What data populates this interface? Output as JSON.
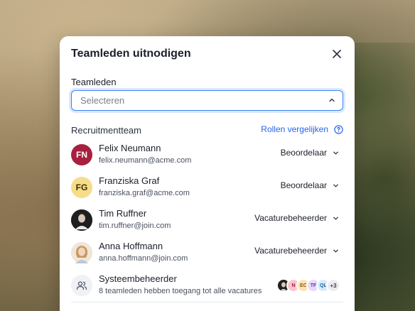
{
  "dialog": {
    "title": "Teamleden uitnodigen",
    "close_icon": "close-icon"
  },
  "team_field": {
    "label": "Teamleden",
    "placeholder": "Selecteren",
    "accent": "#3b82f6"
  },
  "section": {
    "title": "Recruitmentteam",
    "roles_link": "Rollen vergelijken",
    "help_icon": "help-circle-icon",
    "link_color": "#2563eb"
  },
  "members": [
    {
      "initials": "FN",
      "name": "Felix Neumann",
      "email": "felix.neumann@acme.com",
      "role": "Beoordelaar",
      "avatar_bg": "#a8203f",
      "avatar_fg": "#ffffff"
    },
    {
      "initials": "FG",
      "name": "Franziska Graf",
      "email": "franziska.graf@acme.com",
      "role": "Beoordelaar",
      "avatar_bg": "#f6dd8a",
      "avatar_fg": "#3b3000"
    },
    {
      "initials": "",
      "name": "Tim Ruffner",
      "email": "tim.ruffner@join.com",
      "role": "Vacaturebeheerder",
      "avatar_bg": "#1f1f1f",
      "avatar_fg": "#ffffff"
    },
    {
      "initials": "",
      "name": "Anna Hoffmann",
      "email": "anna.hoffmann@join.com",
      "role": "Vacaturebeheerder",
      "avatar_bg": "#e9c9a2",
      "avatar_fg": "#3b2a15"
    }
  ],
  "admin": {
    "name": "Systeembeheerder",
    "description": "8 teamleden hebben toegang tot alle vacatures",
    "icon": "users-icon",
    "stack": [
      {
        "text": "",
        "bg": "#222222",
        "fg": "#ffffff"
      },
      {
        "text": "N",
        "bg": "#f9c6cf",
        "fg": "#a8203f"
      },
      {
        "text": "EC",
        "bg": "#fde2b8",
        "fg": "#8a5a00"
      },
      {
        "text": "TF",
        "bg": "#e6d9fb",
        "fg": "#5b3aa8"
      },
      {
        "text": "QL",
        "bg": "#d6ebfb",
        "fg": "#1f5f99"
      },
      {
        "text": "+3",
        "bg": "#ececee",
        "fg": "#3a3f4b"
      }
    ]
  }
}
